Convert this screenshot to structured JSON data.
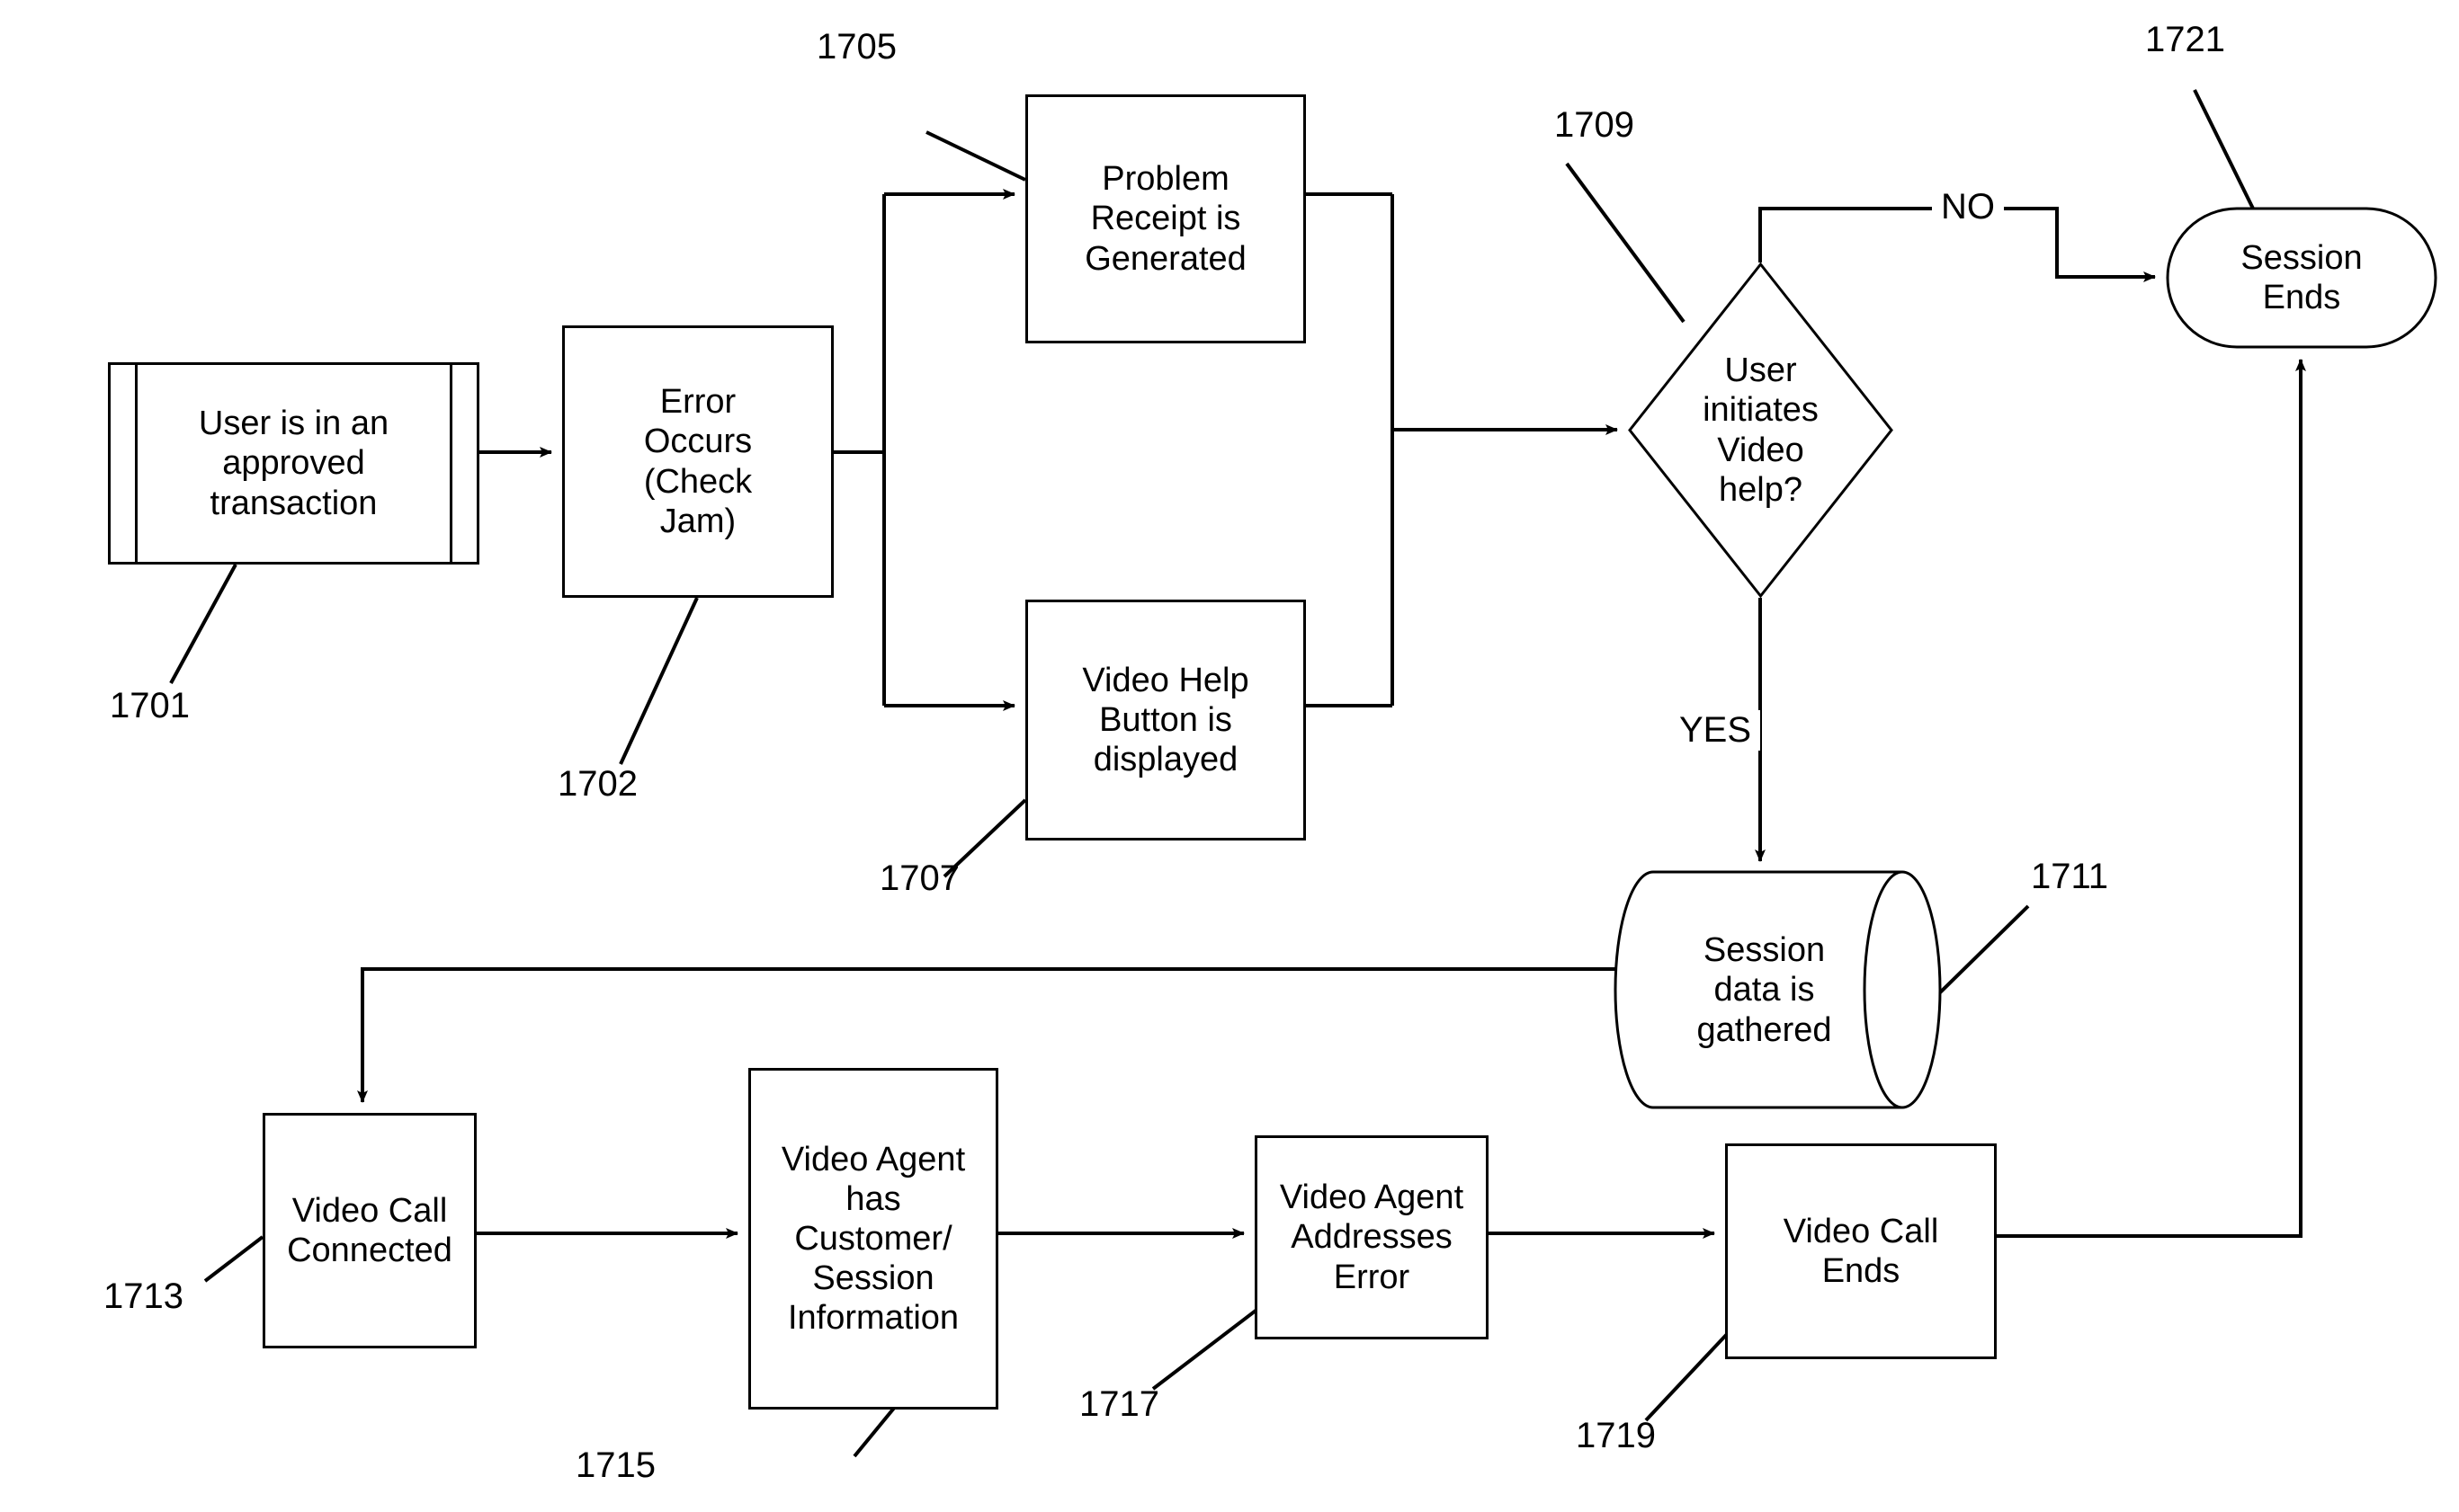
{
  "figure": {
    "type": "patent-flowchart",
    "background": "#ffffff",
    "line_color": "#000000"
  },
  "nodes": {
    "n1701": {
      "label": "User is in an\napproved\ntransaction",
      "shape": "predefined-process",
      "ref": "1701"
    },
    "n1702": {
      "label": "Error\nOccurs\n(Check\nJam)",
      "shape": "process",
      "ref": "1702"
    },
    "n1705": {
      "label": "Problem\nReceipt is\nGenerated",
      "shape": "process",
      "ref": "1705"
    },
    "n1707": {
      "label": "Video Help\nButton is\ndisplayed",
      "shape": "process",
      "ref": "1707"
    },
    "n1709": {
      "label": "User\ninitiates\nVideo\nhelp?",
      "shape": "decision",
      "ref": "1709"
    },
    "n1711": {
      "label": "Session\ndata is\ngathered",
      "shape": "database-cylinder",
      "ref": "1711"
    },
    "n1713": {
      "label": "Video Call\nConnected",
      "shape": "process",
      "ref": "1713"
    },
    "n1715": {
      "label": "Video Agent\nhas\nCustomer/\nSession\nInformation",
      "shape": "process",
      "ref": "1715"
    },
    "n1717": {
      "label": "Video Agent\nAddresses\nError",
      "shape": "process",
      "ref": "1717"
    },
    "n1719": {
      "label": "Video Call\nEnds",
      "shape": "process",
      "ref": "1719"
    },
    "n1721": {
      "label": "Session\nEnds",
      "shape": "terminator-stadium",
      "ref": "1721"
    }
  },
  "edge_labels": {
    "no": "NO",
    "yes": "YES"
  },
  "reference_numerals": {
    "r1701": "1701",
    "r1702": "1702",
    "r1705": "1705",
    "r1707": "1707",
    "r1709": "1709",
    "r1711": "1711",
    "r1713": "1713",
    "r1715": "1715",
    "r1717": "1717",
    "r1719": "1719",
    "r1721": "1721"
  }
}
